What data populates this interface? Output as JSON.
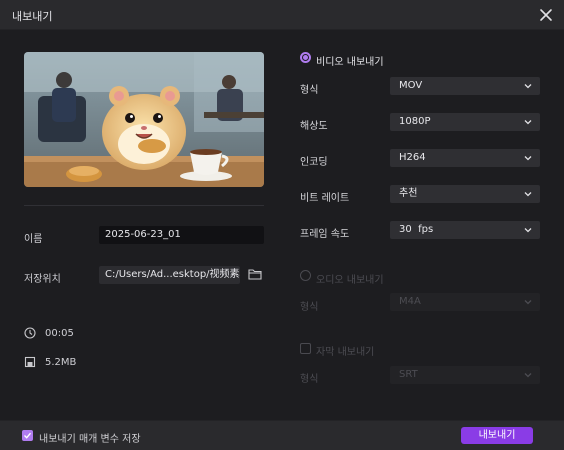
{
  "window": {
    "title": "내보내기"
  },
  "left": {
    "name_label": "이름",
    "name_value": "2025-06-23_01",
    "location_label": "저장위치",
    "location_value": "C:/Users/Ad...esktop/视频素材",
    "duration": "00:05",
    "size": "5.2MB"
  },
  "video": {
    "section_label": "비디오 내보내기",
    "enabled": true,
    "rows": [
      {
        "label": "형식",
        "value": "MOV"
      },
      {
        "label": "해상도",
        "value": "1080P"
      },
      {
        "label": "인코딩",
        "value": "H264"
      },
      {
        "label": "비트 레이트",
        "value": "추천"
      },
      {
        "label": "프레임 속도",
        "value": "30  fps"
      }
    ]
  },
  "audio": {
    "section_label": "오디오 내보내기",
    "enabled": false,
    "format_label": "형식",
    "format_value": "M4A"
  },
  "subtitle": {
    "section_label": "자막 내보내기",
    "enabled": false,
    "format_label": "형식",
    "format_value": "SRT"
  },
  "footer": {
    "save_params_label": "내보내기 매개 변수 저장",
    "save_params_checked": true,
    "export_label": "내보내기"
  },
  "colors": {
    "accent": "#8a3ce6",
    "accent_light": "#b07cf0",
    "background": "#1e1e21"
  }
}
